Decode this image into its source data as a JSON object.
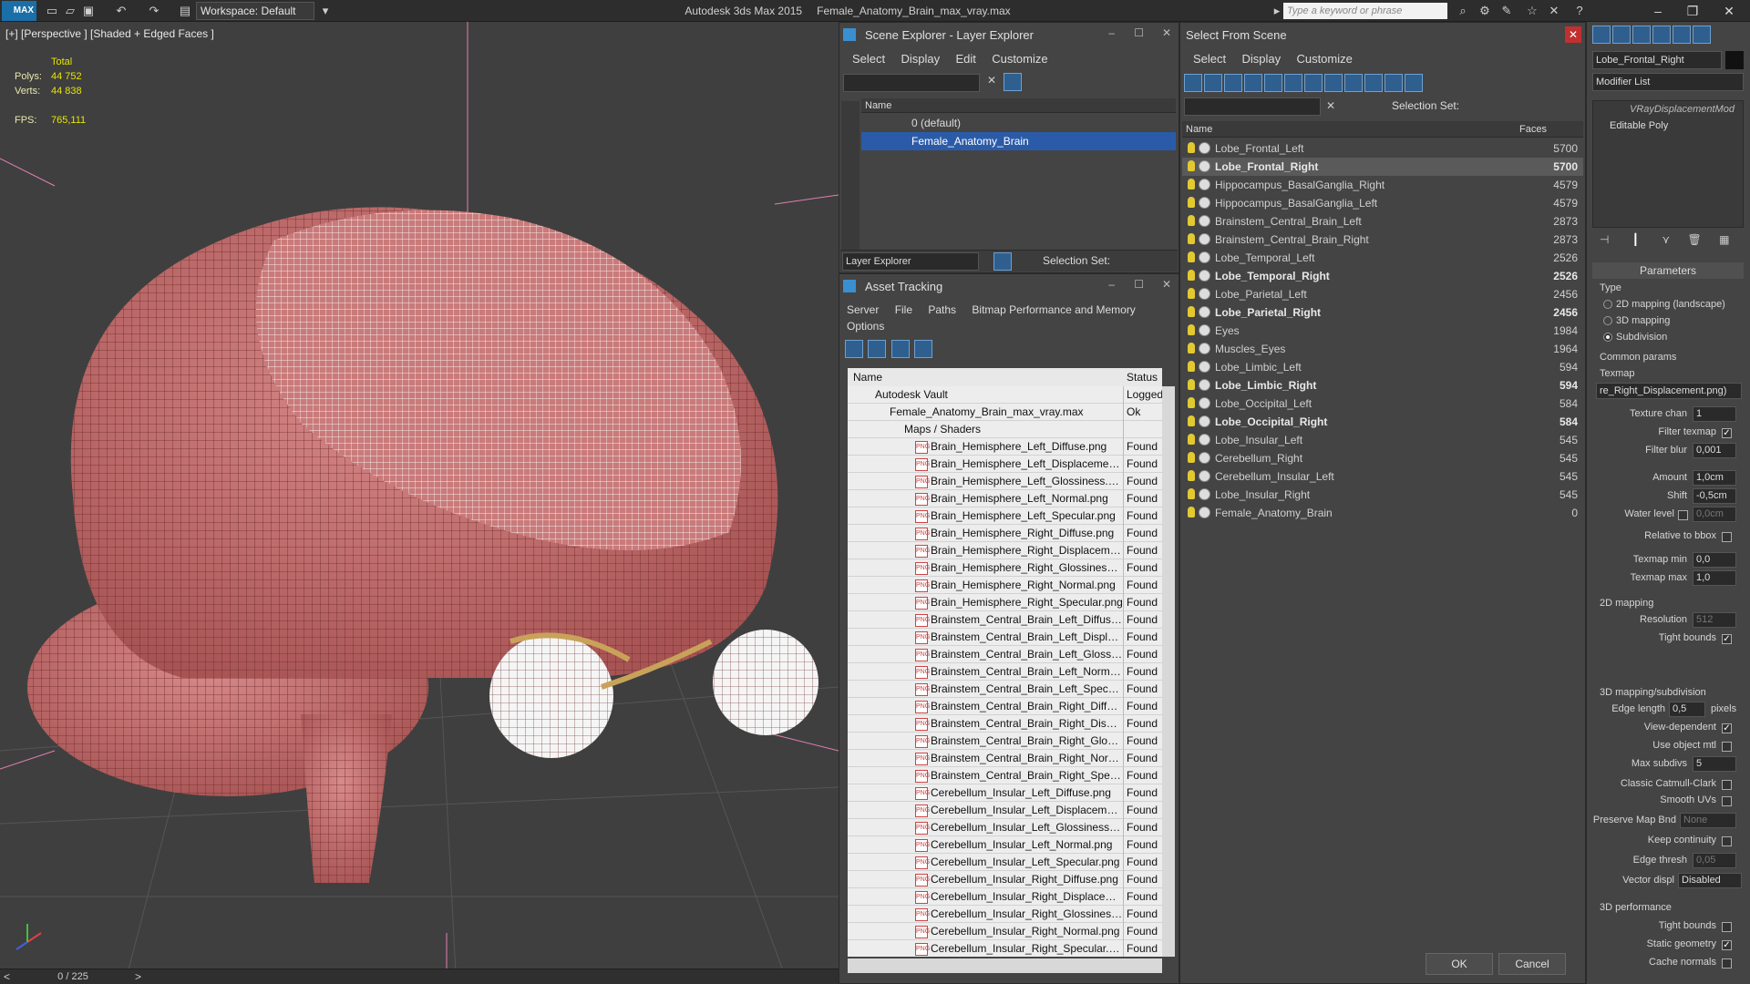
{
  "titlebar": {
    "logo": "MAX",
    "workspace": "Workspace: Default",
    "app": "Autodesk 3ds Max  2015",
    "file": "Female_Anatomy_Brain_max_vray.max",
    "search_placeholder": "Type a keyword or phrase"
  },
  "viewport": {
    "label": "[+] [Perspective ] [Shaded + Edged Faces ]",
    "stats": {
      "total_label": "Total",
      "polys_label": "Polys:",
      "polys": "44 752",
      "verts_label": "Verts:",
      "verts": "44 838",
      "fps_label": "FPS:",
      "fps": "765,111"
    },
    "timeline": "0 / 225"
  },
  "scene_explorer": {
    "title": "Scene Explorer - Layer Explorer",
    "menu": [
      "Select",
      "Display",
      "Edit",
      "Customize"
    ],
    "col_name": "Name",
    "layers": [
      "0 (default)",
      "Female_Anatomy_Brain"
    ],
    "footer_dropdown": "Layer Explorer",
    "selection_set": "Selection Set:"
  },
  "asset_tracking": {
    "title": "Asset Tracking",
    "menu": [
      "Server",
      "File",
      "Paths",
      "Bitmap Performance and Memory",
      "Options"
    ],
    "col_name": "Name",
    "col_status": "Status",
    "vault": {
      "name": "Autodesk Vault",
      "status": "Logged"
    },
    "file": {
      "name": "Female_Anatomy_Brain_max_vray.max",
      "status": "Ok"
    },
    "maps_group": "Maps / Shaders",
    "status_found": "Found",
    "maps": [
      "Brain_Hemisphere_Left_Diffuse.png",
      "Brain_Hemisphere_Left_Displacement...",
      "Brain_Hemisphere_Left_Glossiness.png",
      "Brain_Hemisphere_Left_Normal.png",
      "Brain_Hemisphere_Left_Specular.png",
      "Brain_Hemisphere_Right_Diffuse.png",
      "Brain_Hemisphere_Right_Displacemen...",
      "Brain_Hemisphere_Right_Glossiness.p...",
      "Brain_Hemisphere_Right_Normal.png",
      "Brain_Hemisphere_Right_Specular.png",
      "Brainstem_Central_Brain_Left_Diffuse....",
      "Brainstem_Central_Brain_Left_Displace...",
      "Brainstem_Central_Brain_Left_Glossine...",
      "Brainstem_Central_Brain_Left_Normal....",
      "Brainstem_Central_Brain_Left_Specula...",
      "Brainstem_Central_Brain_Right_Diffus...",
      "Brainstem_Central_Brain_Right_Displa...",
      "Brainstem_Central_Brain_Right_Glossi...",
      "Brainstem_Central_Brain_Right_Norm...",
      "Brainstem_Central_Brain_Right_Specul...",
      "Cerebellum_Insular_Left_Diffuse.png",
      "Cerebellum_Insular_Left_Displacemen...",
      "Cerebellum_Insular_Left_Glossiness.png",
      "Cerebellum_Insular_Left_Normal.png",
      "Cerebellum_Insular_Left_Specular.png",
      "Cerebellum_Insular_Right_Diffuse.png",
      "Cerebellum_Insular_Right_Displaceme...",
      "Cerebellum_Insular_Right_Glossiness....",
      "Cerebellum_Insular_Right_Normal.png",
      "Cerebellum_Insular_Right_Specular.png"
    ]
  },
  "select_from_scene": {
    "title": "Select From Scene",
    "menu": [
      "Select",
      "Display",
      "Customize"
    ],
    "selection_set": "Selection Set:",
    "col_name": "Name",
    "col_faces": "Faces",
    "objects": [
      {
        "name": "Lobe_Frontal_Left",
        "faces": "5700",
        "bold": false,
        "hl": false
      },
      {
        "name": "Lobe_Frontal_Right",
        "faces": "5700",
        "bold": true,
        "hl": true
      },
      {
        "name": "Hippocampus_BasalGanglia_Right",
        "faces": "4579",
        "bold": false,
        "hl": false
      },
      {
        "name": "Hippocampus_BasalGanglia_Left",
        "faces": "4579",
        "bold": false,
        "hl": false
      },
      {
        "name": "Brainstem_Central_Brain_Left",
        "faces": "2873",
        "bold": false,
        "hl": false
      },
      {
        "name": "Brainstem_Central_Brain_Right",
        "faces": "2873",
        "bold": false,
        "hl": false
      },
      {
        "name": "Lobe_Temporal_Left",
        "faces": "2526",
        "bold": false,
        "hl": false
      },
      {
        "name": "Lobe_Temporal_Right",
        "faces": "2526",
        "bold": true,
        "hl": false
      },
      {
        "name": "Lobe_Parietal_Left",
        "faces": "2456",
        "bold": false,
        "hl": false
      },
      {
        "name": "Lobe_Parietal_Right",
        "faces": "2456",
        "bold": true,
        "hl": false
      },
      {
        "name": "Eyes",
        "faces": "1984",
        "bold": false,
        "hl": false
      },
      {
        "name": "Muscles_Eyes",
        "faces": "1964",
        "bold": false,
        "hl": false
      },
      {
        "name": "Lobe_Limbic_Left",
        "faces": "594",
        "bold": false,
        "hl": false
      },
      {
        "name": "Lobe_Limbic_Right",
        "faces": "594",
        "bold": true,
        "hl": false
      },
      {
        "name": "Lobe_Occipital_Left",
        "faces": "584",
        "bold": false,
        "hl": false
      },
      {
        "name": "Lobe_Occipital_Right",
        "faces": "584",
        "bold": true,
        "hl": false
      },
      {
        "name": "Lobe_Insular_Left",
        "faces": "545",
        "bold": false,
        "hl": false
      },
      {
        "name": "Cerebellum_Right",
        "faces": "545",
        "bold": false,
        "hl": false
      },
      {
        "name": "Cerebellum_Insular_Left",
        "faces": "545",
        "bold": false,
        "hl": false
      },
      {
        "name": "Lobe_Insular_Right",
        "faces": "545",
        "bold": false,
        "hl": false
      },
      {
        "name": "Female_Anatomy_Brain",
        "faces": "0",
        "bold": false,
        "hl": false
      }
    ],
    "ok": "OK",
    "cancel": "Cancel"
  },
  "command_panel": {
    "object_name": "Lobe_Frontal_Right",
    "modifier_list": "Modifier List",
    "stack": [
      "VRayDisplacementMod",
      "Editable Poly"
    ],
    "parameters": "Parameters",
    "type_label": "Type",
    "types": [
      "2D mapping (landscape)",
      "3D mapping",
      "Subdivision"
    ],
    "common_params": "Common params",
    "texmap": "Texmap",
    "texmap_value": "re_Right_Displacement.png)",
    "texture_chan": "Texture chan",
    "texture_chan_val": "1",
    "filter_texmap": "Filter texmap",
    "filter_blur": "Filter blur",
    "filter_blur_val": "0,001",
    "amount": "Amount",
    "amount_val": "1,0cm",
    "shift": "Shift",
    "shift_val": "-0,5cm",
    "water_level": "Water level",
    "water_level_val": "0,0cm",
    "relative_bbox": "Relative to bbox",
    "texmap_min": "Texmap min",
    "texmap_min_val": "0,0",
    "texmap_max": "Texmap max",
    "texmap_max_val": "1,0",
    "mapping2d": "2D mapping",
    "resolution": "Resolution",
    "resolution_val": "512",
    "tight_bounds": "Tight bounds",
    "mapping3d": "3D mapping/subdivision",
    "edge_length": "Edge length",
    "edge_length_val": "0,5",
    "pixels": "pixels",
    "view_dependent": "View-dependent",
    "use_object_mtl": "Use object mtl",
    "max_subdivs": "Max subdivs",
    "max_subdivs_val": "5",
    "classic_cc": "Classic Catmull-Clark",
    "smooth_uvs": "Smooth UVs",
    "preserve_map": "Preserve Map Bnd",
    "preserve_map_val": "None",
    "keep_continuity": "Keep continuity",
    "edge_thresh": "Edge thresh",
    "edge_thresh_val": "0,05",
    "vector_displ": "Vector displ",
    "vector_displ_val": "Disabled",
    "perf3d": "3D performance",
    "tight_bounds2": "Tight bounds",
    "static_geometry": "Static geometry",
    "cache_normals": "Cache normals"
  },
  "colors": {
    "accent": "#2b5ba8",
    "wire": "#ffffff",
    "brain": "#c06868",
    "bg": "#444444"
  }
}
